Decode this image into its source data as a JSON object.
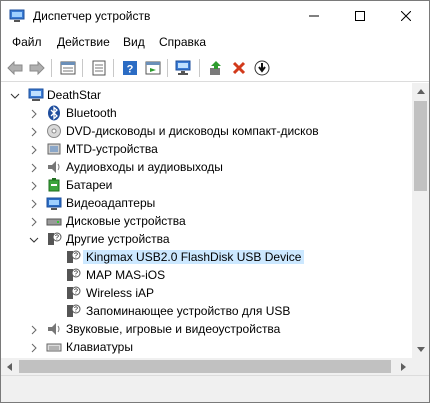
{
  "window": {
    "title": "Диспетчер устройств",
    "icon": "device-manager-icon"
  },
  "menu": [
    {
      "label": "Файл"
    },
    {
      "label": "Действие"
    },
    {
      "label": "Вид"
    },
    {
      "label": "Справка"
    }
  ],
  "toolbar": {
    "icons": [
      "back-icon",
      "forward-icon",
      "properties-pane-icon",
      "properties-icon",
      "help-icon",
      "action-pane-icon",
      "scan-hardware-icon",
      "update-driver-icon",
      "uninstall-device-icon",
      "disable-device-icon"
    ]
  },
  "tree": {
    "root": "DeathStar",
    "items": [
      {
        "label": "Bluetooth",
        "icon": "bluetooth-icon"
      },
      {
        "label": "DVD-дисководы и дисководы компакт-дисков",
        "icon": "dvd-drive-icon"
      },
      {
        "label": "MTD-устройства",
        "icon": "mtd-device-icon"
      },
      {
        "label": "Аудиовходы и аудиовыходы",
        "icon": "audio-icon"
      },
      {
        "label": "Батареи",
        "icon": "battery-icon"
      },
      {
        "label": "Видеоадаптеры",
        "icon": "display-adapter-icon"
      },
      {
        "label": "Дисковые устройства",
        "icon": "disk-drive-icon"
      },
      {
        "label": "Другие устройства",
        "icon": "unknown-device-icon",
        "expanded": true,
        "children": [
          {
            "label": "Kingmax USB2.0 FlashDisk USB Device",
            "selected": true
          },
          {
            "label": "MAP MAS-iOS"
          },
          {
            "label": "Wireless iAP"
          },
          {
            "label": "Запоминающее устройство для USB"
          }
        ]
      },
      {
        "label": "Звуковые, игровые и видеоустройства",
        "icon": "sound-icon"
      },
      {
        "label": "Клавиатуры",
        "icon": "keyboard-icon"
      }
    ]
  }
}
